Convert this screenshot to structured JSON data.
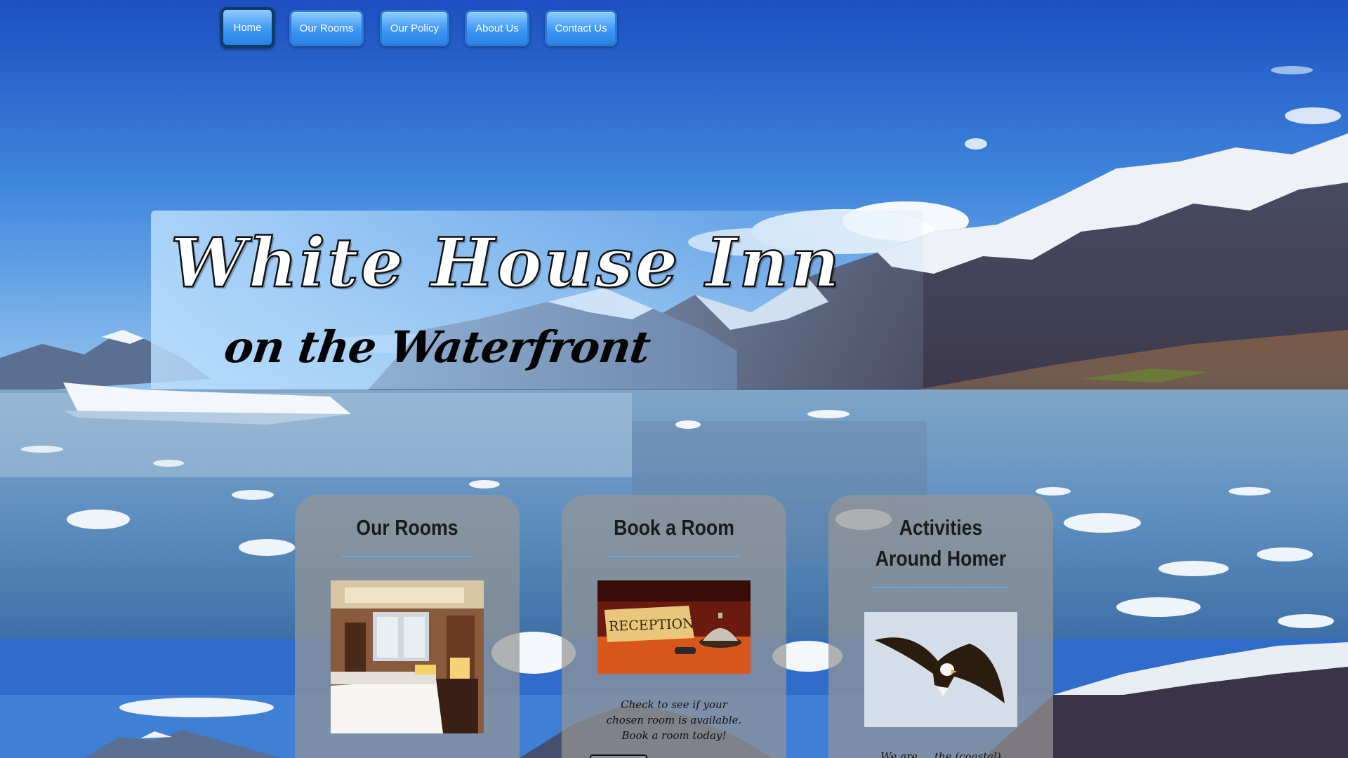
{
  "nav": {
    "items": [
      {
        "label": "Home",
        "active": true
      },
      {
        "label": "Our Rooms",
        "active": false
      },
      {
        "label": "Our Policy",
        "active": false
      },
      {
        "label": "About Us",
        "active": false
      },
      {
        "label": "Contact Us",
        "active": false
      }
    ]
  },
  "hero": {
    "title": "White House Inn",
    "subtitle": "on the Waterfront"
  },
  "cards": [
    {
      "title": "Our Rooms",
      "image": "hotel-room-photo"
    },
    {
      "title": "Book a Room",
      "image": "reception-bell-photo",
      "text": "Check to see if your chosen room is available. Book a room today!"
    },
    {
      "title": "Activities Around Homer",
      "image": "bald-eagle-photo",
      "text": "We are ... the (coastal)"
    }
  ],
  "colors": {
    "nav_button": "#3f98f4",
    "nav_active_border": "#0d3a66",
    "card_bg": "#969696",
    "card_rule": "#5fa6e6",
    "sky": "#2a62c9"
  }
}
